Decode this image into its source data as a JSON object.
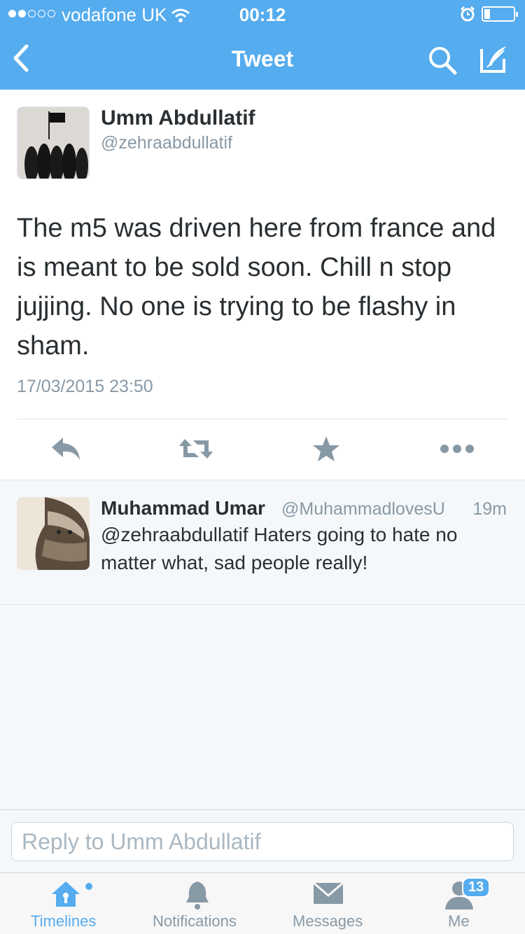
{
  "status_bar": {
    "carrier": "vodafone UK",
    "time": "00:12",
    "signal_bars_filled": 2,
    "signal_bars_total": 5,
    "battery_level": 0.15
  },
  "nav": {
    "title": "Tweet",
    "back_icon": "chevron-left-icon",
    "search_icon": "search-icon",
    "compose_icon": "compose-icon"
  },
  "tweet": {
    "author_name": "Umm Abdullatif",
    "author_handle": "@zehraabdullatif",
    "text": "The m5 was driven here from france and is meant to be sold soon. Chill n stop jujjing. No one is trying to be flashy in sham.",
    "timestamp": "17/03/2015 23:50",
    "actions": [
      "reply-icon",
      "retweet-icon",
      "favorite-icon",
      "more-icon"
    ]
  },
  "reply": {
    "name": "Muhammad Umar",
    "handle": "@MuhammadlovesU",
    "age": "19m",
    "text": "@zehraabdullatif Haters going to hate no matter what, sad people really!"
  },
  "composer": {
    "placeholder": "Reply to Umm Abdullatif"
  },
  "tabbar": {
    "tabs": [
      {
        "label": "Timelines",
        "icon": "home-icon",
        "active": true
      },
      {
        "label": "Notifications",
        "icon": "bell-icon",
        "active": false
      },
      {
        "label": "Messages",
        "icon": "envelope-icon",
        "active": false
      },
      {
        "label": "Me",
        "icon": "people-icon",
        "active": false,
        "badge": "13"
      }
    ]
  },
  "colors": {
    "brand": "#55acee",
    "text": "#292f33",
    "muted": "#8899a6",
    "border": "#e1e8ed",
    "background": "#f5f8fa"
  }
}
